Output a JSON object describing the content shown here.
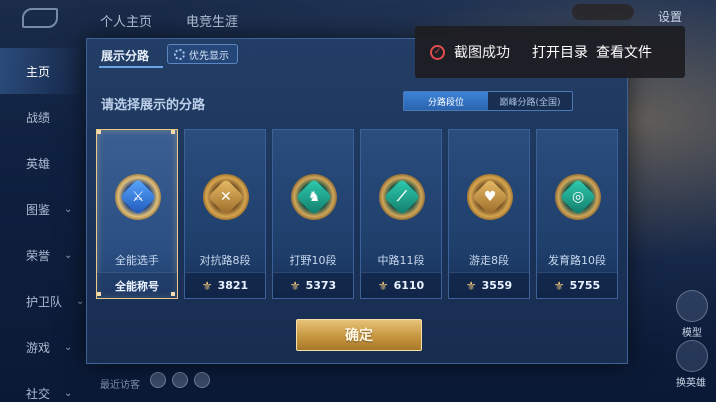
{
  "background": {
    "top_tabs": [
      "个人主页",
      "电竞生涯"
    ],
    "settings_label": "设置",
    "sidebar": [
      {
        "label": "主页",
        "active": true,
        "chevron": false
      },
      {
        "label": "战绩",
        "active": false,
        "chevron": false
      },
      {
        "label": "英雄",
        "active": false,
        "chevron": false
      },
      {
        "label": "图鉴",
        "active": false,
        "chevron": true
      },
      {
        "label": "荣誉",
        "active": false,
        "chevron": true
      },
      {
        "label": "护卫队",
        "active": false,
        "chevron": true
      },
      {
        "label": "游戏",
        "active": false,
        "chevron": true
      },
      {
        "label": "社交",
        "active": false,
        "chevron": true
      }
    ],
    "recent_visitors_label": "最近访客",
    "right_labels": [
      "模型",
      "换英雄"
    ]
  },
  "dialog": {
    "title": "展示分路",
    "priority_button": "优先显示",
    "prompt": "请选择展示的分路",
    "segment": {
      "options": [
        "分路段位",
        "巅峰分路(全国)"
      ],
      "active_index": 0
    },
    "cards": [
      {
        "label": "全能选手",
        "footer": "全能称号",
        "emblem": "blue",
        "glyph": "⚔",
        "selected": true,
        "power": false
      },
      {
        "label": "对抗路8段",
        "footer": "3821",
        "emblem": "gold",
        "glyph": "✕",
        "selected": false,
        "power": true
      },
      {
        "label": "打野10段",
        "footer": "5373",
        "emblem": "teal",
        "glyph": "♞",
        "selected": false,
        "power": true
      },
      {
        "label": "中路11段",
        "footer": "6110",
        "emblem": "teal",
        "glyph": "⟋",
        "selected": false,
        "power": true
      },
      {
        "label": "游走8段",
        "footer": "3559",
        "emblem": "gold",
        "glyph": "♥",
        "selected": false,
        "power": true
      },
      {
        "label": "发育路10段",
        "footer": "5755",
        "emblem": "teal",
        "glyph": "◎",
        "selected": false,
        "power": true
      }
    ],
    "confirm_label": "确定"
  },
  "toast": {
    "message": "截图成功",
    "open_folder": "打开目录",
    "view_file": "查看文件"
  },
  "colors": {
    "accent_gold": "#e9c98a",
    "active_tab_blue": "#3d82d6",
    "toast_error_red": "#e24c4c"
  }
}
